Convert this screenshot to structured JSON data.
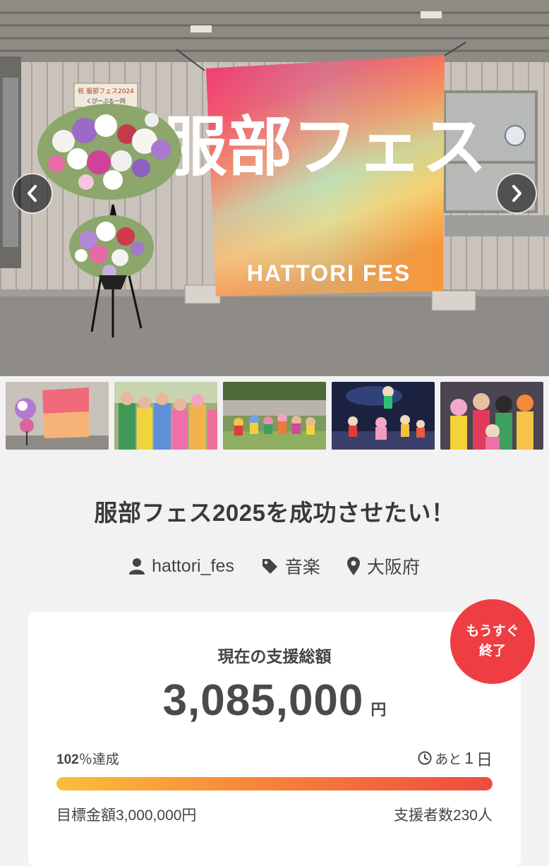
{
  "hero": {
    "banner_title": "服部フェス",
    "banner_subtitle": "HATTORI FES",
    "flower_sign": "祝 服部フェス2024",
    "flower_sign_sub": "くぴーぷる一同"
  },
  "thumbnails": [
    {
      "label": "thumb-banner"
    },
    {
      "label": "thumb-group-photo"
    },
    {
      "label": "thumb-outdoor"
    },
    {
      "label": "thumb-stage"
    },
    {
      "label": "thumb-closeup"
    }
  ],
  "project": {
    "title": "服部フェス2025を成功させたい！",
    "owner": "hattori_fes",
    "category": "音楽",
    "location": "大阪府"
  },
  "stats": {
    "badge_line1": "もうすぐ",
    "badge_line2": "終了",
    "total_label": "現在の支援総額",
    "total_amount": "3,085,000",
    "currency_unit": "円",
    "percent_value": "102",
    "percent_suffix": "％達成",
    "remaining_prefix": "あと",
    "remaining_days": "1",
    "remaining_unit": "日",
    "progress_fraction": 1.0,
    "goal_text": "目標金額3,000,000円",
    "backers_text": "支援者数230人"
  },
  "colors": {
    "accent_red": "#ee3d43",
    "progress_start": "#fbbf3a",
    "progress_end": "#ef4b3f"
  }
}
